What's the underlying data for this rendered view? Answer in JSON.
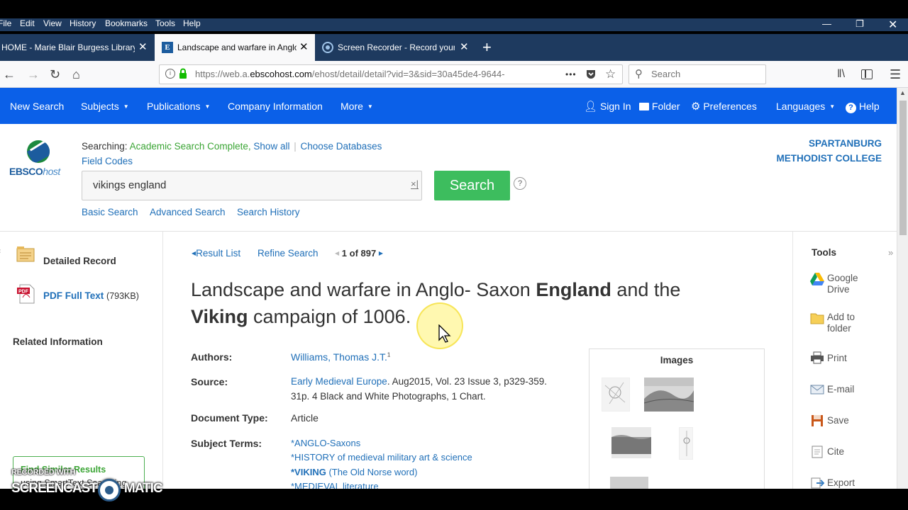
{
  "menubar": {
    "items": [
      "File",
      "Edit",
      "View",
      "History",
      "Bookmarks",
      "Tools",
      "Help"
    ]
  },
  "tabs": [
    {
      "label": "HOME - Marie Blair Burgess Library",
      "active": false
    },
    {
      "label": "Landscape and warfare in Anglo-",
      "active": true
    },
    {
      "label": "Screen Recorder - Record your",
      "active": false
    }
  ],
  "nav": {
    "url": "https://web.a.ebscohost.com/ehost/detail/detail?vid=3&sid=30a45de4-9644-",
    "url_host_prefix": "https://web.a.",
    "url_host": "ebscohost.com",
    "url_path": "/ehost/detail/detail?vid=3&sid=30a45de4-9644-",
    "search_placeholder": "Search",
    "more_dots": "•••"
  },
  "toolbar": {
    "new_search": "New Search",
    "subjects": "Subjects",
    "publications": "Publications",
    "company_information": "Company Information",
    "more": "More",
    "sign_in": "Sign In",
    "folder": "Folder",
    "preferences": "Preferences",
    "languages": "Languages",
    "help": "Help"
  },
  "search": {
    "searching_label": "Searching:",
    "database": "Academic Search Complete",
    "show_all": "Show all",
    "choose_databases": "Choose Databases",
    "field_codes": "Field Codes",
    "query": "vikings england",
    "search_button": "Search",
    "help": "?",
    "basic_search": "Basic Search",
    "advanced_search": "Advanced Search",
    "search_history": "Search History",
    "logo_main": "EBSCO",
    "logo_sub": "host",
    "institution_line1": "SPARTANBURG",
    "institution_line2": "METHODIST COLLEGE"
  },
  "left": {
    "detailed_record": "Detailed Record",
    "pdf_full_text": "PDF Full Text",
    "pdf_size": "(793KB)",
    "related_information": "Related Information",
    "find_similar": "Find Similar Results",
    "smarttext": "using SmartText Searching."
  },
  "record": {
    "result_list": "Result List",
    "refine_search": "Refine Search",
    "position": "1 of 897",
    "title_part1": "Landscape and warfare in Anglo- Saxon ",
    "title_bold1": "England",
    "title_part2": " and the",
    "title_bold2": "Viking",
    "title_part3": " campaign of 1006.",
    "authors_label": "Authors:",
    "author": "Williams, Thomas J.T.",
    "author_sup": "1",
    "source_label": "Source:",
    "source_journal": "Early Medieval Europe",
    "source_rest": ". Aug2015, Vol. 23 Issue 3, p329-359.",
    "source_line2": "31p. 4 Black and White Photographs, 1 Chart.",
    "doctype_label": "Document Type:",
    "doctype": "Article",
    "subjects_label": "Subject Terms:",
    "subject1": "*ANGLO-Saxons",
    "subject2": "*HISTORY of medieval military art & science",
    "subject3_bold": "*VIKING",
    "subject3_rest": " (The Old Norse word)",
    "subject4": "*MEDIEVAL literature",
    "images_heading": "Images"
  },
  "tools": {
    "heading": "Tools",
    "google_drive_1": "Google",
    "google_drive_2": "Drive",
    "add_folder_1": "Add to",
    "add_folder_2": "folder",
    "print": "Print",
    "email": "E-mail",
    "save": "Save",
    "cite": "Cite",
    "export": "Export"
  },
  "watermark": {
    "line1": "RECORDED WITH",
    "line2a": "SCREENCAST",
    "line2b": "MATIC"
  },
  "colors": {
    "firefox_chrome": "#1e3a5f",
    "ebsco_toolbar": "#0b60e8",
    "link": "#1f6fb8",
    "search_button": "#3dbd5e",
    "database_green": "#3ba535",
    "institution_blue": "#1f6fb8"
  }
}
